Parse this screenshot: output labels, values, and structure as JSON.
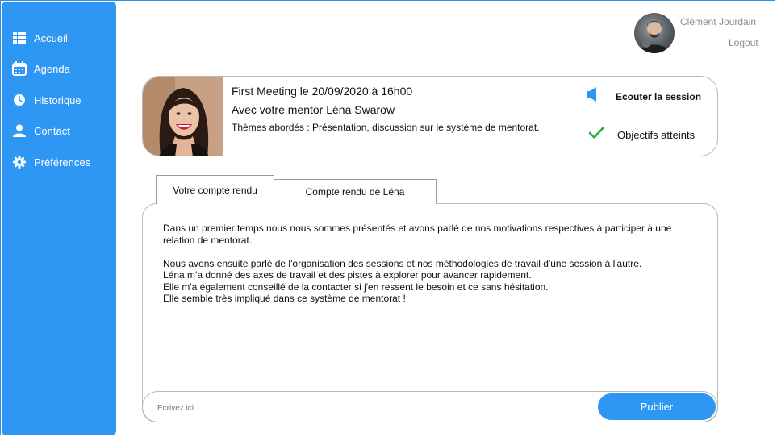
{
  "sidebar": {
    "items": [
      {
        "label": "Accueil",
        "icon": "dashboard-icon"
      },
      {
        "label": "Agenda",
        "icon": "calendar-icon"
      },
      {
        "label": "Historique",
        "icon": "clock-icon"
      },
      {
        "label": "Contact",
        "icon": "person-icon"
      },
      {
        "label": "Préférences",
        "icon": "gear-icon"
      }
    ]
  },
  "user": {
    "name": "Clément Jourdain",
    "logout_label": "Logout"
  },
  "session": {
    "title": "First Meeting le 20/09/2020 à 16h00",
    "mentor": "Avec votre mentor Léna Swarow",
    "themes": "Thèmes abordés : Présentation, discussion sur le système de mentorat.",
    "listen_label": "Ecouter la session",
    "goals_label": "Objectifs atteints"
  },
  "tabs": [
    {
      "label": "Votre compte rendu",
      "active": true
    },
    {
      "label": "Compte rendu de Léna",
      "active": false
    }
  ],
  "report": {
    "paragraph1": "Dans un premier temps nous nous sommes présentés et avons parlé de nos motivations respectives à participer à une relation de mentorat.",
    "line2": "Nous avons ensuite parlé de l'organisation des sessions et nos méthodologies de travail d'une session à l'autre.",
    "line3": "Léna m'a donné des axes de travail et des pistes à explorer pour avancer rapidement.",
    "line4": "Elle m'a également conseillé de la contacter si j'en ressent le besoin et ce sans hésitation.",
    "line5": "Elle semble très impliqué dans ce système de mentorat !"
  },
  "comment": {
    "placeholder": "Ecrivez ici",
    "publish_label": "Publier"
  },
  "colors": {
    "accent": "#2e96f3",
    "check": "#2eaa44"
  }
}
